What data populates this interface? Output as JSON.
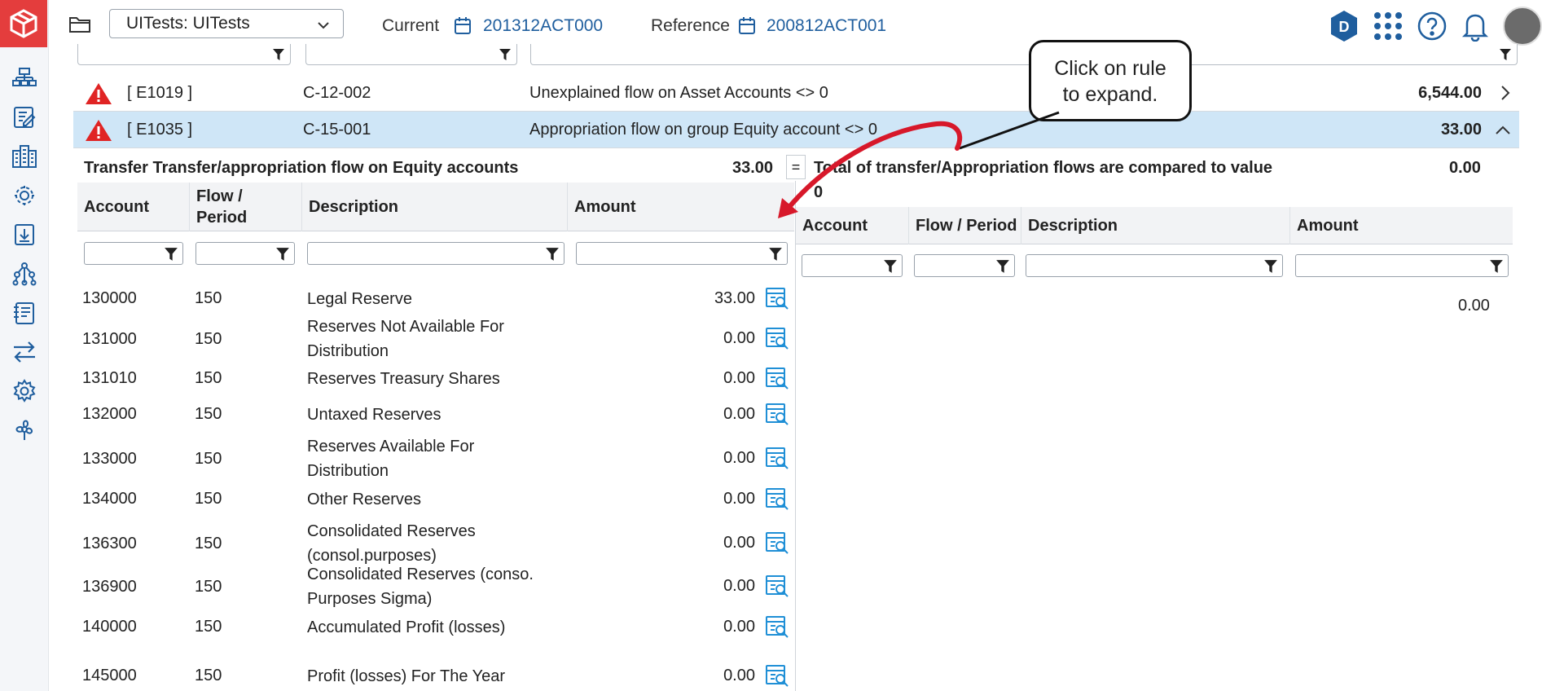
{
  "header": {
    "entity_select": "UITests: UITests",
    "current_label": "Current",
    "current_value": "201312ACT000",
    "reference_label": "Reference",
    "reference_value": "200812ACT001"
  },
  "rules": [
    {
      "code": "[ E1019 ]",
      "ref": "C-12-002",
      "description": "Unexplained flow on Asset Accounts <> 0",
      "amount": "6,544.00",
      "selected": false
    },
    {
      "code": "[ E1035 ]",
      "ref": "C-15-001",
      "description": "Appropriation flow on group Equity account <> 0",
      "amount": "33.00",
      "selected": true
    }
  ],
  "left_panel": {
    "title": "Transfer Transfer/appropriation flow on Equity accounts",
    "total": "33.00",
    "operator": "=",
    "columns": [
      "Account",
      "Flow / Period",
      "Description",
      "Amount"
    ],
    "rows": [
      {
        "account": "130000",
        "flow": "150",
        "description": "Legal Reserve",
        "amount": "33.00"
      },
      {
        "account": "131000",
        "flow": "150",
        "description": "Reserves Not Available For Distribution",
        "amount": "0.00"
      },
      {
        "account": "131010",
        "flow": "150",
        "description": "Reserves Treasury Shares",
        "amount": "0.00"
      },
      {
        "account": "132000",
        "flow": "150",
        "description": "Untaxed Reserves",
        "amount": "0.00"
      },
      {
        "account": "133000",
        "flow": "150",
        "description": "Reserves Available For Distribution",
        "amount": "0.00"
      },
      {
        "account": "134000",
        "flow": "150",
        "description": "Other Reserves",
        "amount": "0.00"
      },
      {
        "account": "136300",
        "flow": "150",
        "description": "Consolidated Reserves (consol.purposes)",
        "amount": "0.00"
      },
      {
        "account": "136900",
        "flow": "150",
        "description": "Consolidated Reserves (conso. Purposes Sigma)",
        "amount": "0.00"
      },
      {
        "account": "140000",
        "flow": "150",
        "description": "Accumulated Profit (losses)",
        "amount": "0.00"
      },
      {
        "account": "145000",
        "flow": "150",
        "description": "Profit (losses) For The Year",
        "amount": "0.00"
      }
    ]
  },
  "right_panel": {
    "title_line1": "Total of transfer/Appropriation flows are compared to value",
    "title_line2": "0",
    "total": "0.00",
    "columns": [
      "Account",
      "Flow / Period",
      "Description",
      "Amount"
    ],
    "row_total": "0.00"
  },
  "callout": {
    "text_line1": "Click on rule",
    "text_line2": "to expand."
  },
  "colors": {
    "brand": "#e43d3d",
    "link": "#1f5e9e",
    "icon": "#1f5e9e",
    "selected_row": "#cfe6f7",
    "arrow": "#d7182a"
  }
}
